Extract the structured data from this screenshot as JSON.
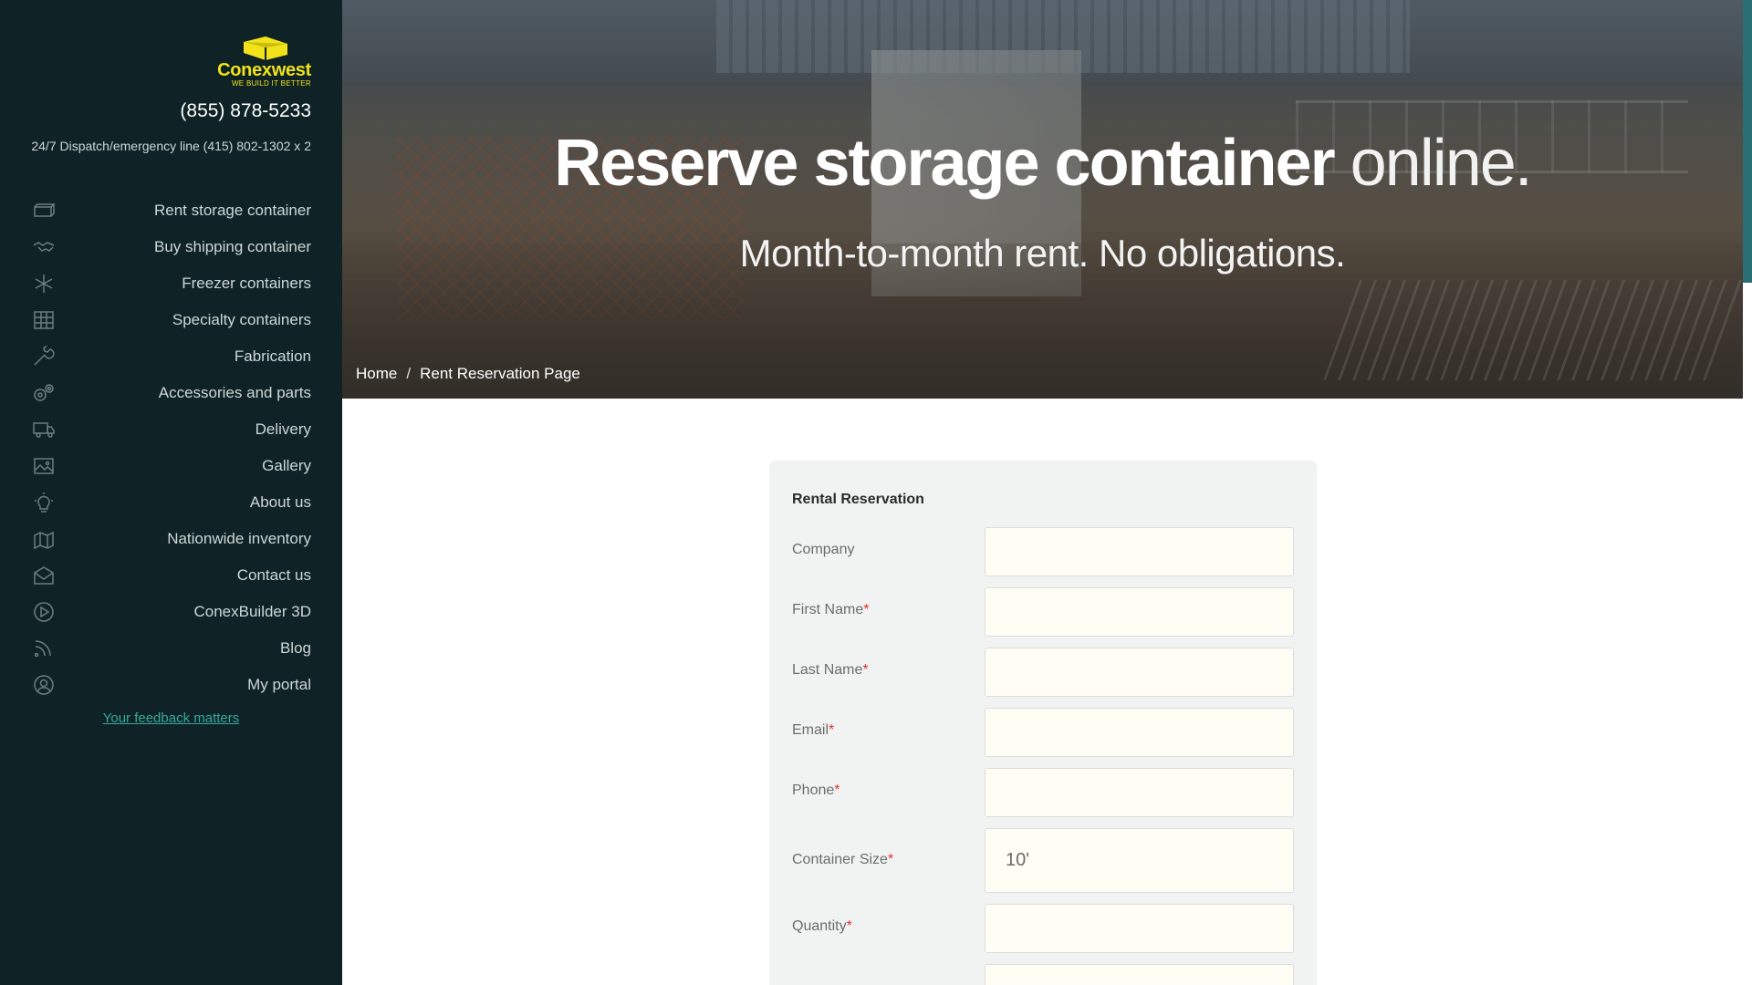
{
  "brand": {
    "name": "Conexwest",
    "tagline": "WE BUILD IT BETTER",
    "color": "#f2e21a"
  },
  "contact": {
    "phone": "(855) 878-5233",
    "dispatch": "24/7 Dispatch/emergency line (415) 802-1302 x 2"
  },
  "sidebar": {
    "items": [
      {
        "label": "Rent storage container",
        "icon": "container-rent-icon"
      },
      {
        "label": "Buy shipping container",
        "icon": "handshake-icon"
      },
      {
        "label": "Freezer containers",
        "icon": "snowflake-icon"
      },
      {
        "label": "Specialty containers",
        "icon": "grid-icon"
      },
      {
        "label": "Fabrication",
        "icon": "wrench-icon"
      },
      {
        "label": "Accessories and parts",
        "icon": "gears-icon"
      },
      {
        "label": "Delivery",
        "icon": "truck-icon"
      },
      {
        "label": "Gallery",
        "icon": "image-icon"
      },
      {
        "label": "About us",
        "icon": "lightbulb-icon"
      },
      {
        "label": "Nationwide inventory",
        "icon": "map-icon"
      },
      {
        "label": "Contact us",
        "icon": "envelope-icon"
      },
      {
        "label": "ConexBuilder 3D",
        "icon": "play-icon"
      },
      {
        "label": "Blog",
        "icon": "rss-icon"
      },
      {
        "label": "My portal",
        "icon": "user-icon"
      }
    ],
    "feedback_link": "Your feedback matters"
  },
  "hero": {
    "title_bold": "Reserve storage container",
    "title_light": " online.",
    "subtitle": "Month-to-month rent. No obligations."
  },
  "breadcrumb": {
    "home": "Home",
    "separator": "/",
    "current": "Rent Reservation Page"
  },
  "form": {
    "title": "Rental Reservation",
    "fields": [
      {
        "label": "Company",
        "required": false,
        "value": ""
      },
      {
        "label": "First Name",
        "required": true,
        "value": ""
      },
      {
        "label": "Last Name",
        "required": true,
        "value": ""
      },
      {
        "label": "Email",
        "required": true,
        "value": ""
      },
      {
        "label": "Phone",
        "required": true,
        "value": ""
      },
      {
        "label": "Container Size",
        "required": true,
        "value": "10'"
      },
      {
        "label": "Quantity",
        "required": true,
        "value": ""
      }
    ],
    "required_marker": "*"
  },
  "colors": {
    "sidebar_bg": "#0f2326",
    "accent": "#39a89c",
    "scrollbar": "#2a6f73",
    "required": "#dd3333"
  }
}
